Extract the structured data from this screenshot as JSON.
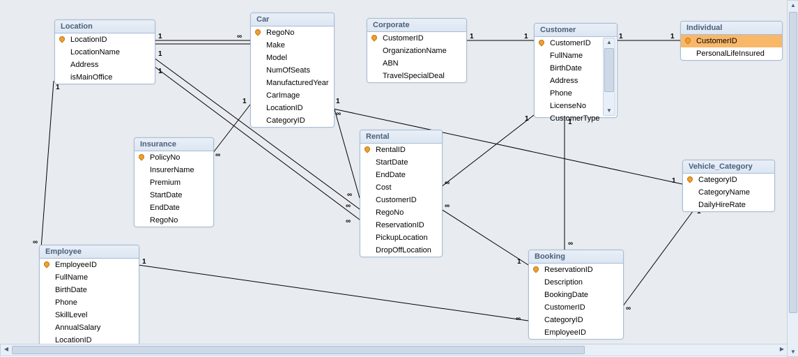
{
  "app": "Microsoft Access Relationships",
  "colors": {
    "canvas": "#e8ecf0",
    "entity_border": "#a7bcd8",
    "title_bg": "#dce6f2",
    "selected": "#f9b769",
    "pk_icon": "#f0a030"
  },
  "entities": [
    {
      "name": "Location",
      "pk": [
        "LocationID"
      ],
      "fields": [
        "LocationID",
        "LocationName",
        "Address",
        "isMainOffice"
      ]
    },
    {
      "name": "Car",
      "pk": [
        "RegoNo"
      ],
      "fields": [
        "RegoNo",
        "Make",
        "Model",
        "NumOfSeats",
        "ManufacturedYear",
        "CarImage",
        "LocationID",
        "CategoryID"
      ]
    },
    {
      "name": "Corporate",
      "pk": [
        "CustomerID"
      ],
      "fields": [
        "CustomerID",
        "OrganizationName",
        "ABN",
        "TravelSpecialDeal"
      ]
    },
    {
      "name": "Customer",
      "pk": [
        "CustomerID"
      ],
      "fields": [
        "CustomerID",
        "FullName",
        "BirthDate",
        "Address",
        "Phone",
        "LicenseNo",
        "CustomerType"
      ],
      "has_scroll": true
    },
    {
      "name": "Individual",
      "pk": [
        "CustomerID"
      ],
      "fields": [
        "CustomerID",
        "PersonalLifeInsured"
      ],
      "selected_field": "CustomerID"
    },
    {
      "name": "Insurance",
      "pk": [
        "PolicyNo"
      ],
      "fields": [
        "PolicyNo",
        "InsurerName",
        "Premium",
        "StartDate",
        "EndDate",
        "RegoNo"
      ]
    },
    {
      "name": "Rental",
      "pk": [
        "RentalID"
      ],
      "fields": [
        "RentalID",
        "StartDate",
        "EndDate",
        "Cost",
        "CustomerID",
        "RegoNo",
        "ReservationID",
        "PickupLocation",
        "DropOffLocation"
      ]
    },
    {
      "name": "Vehicle_Category",
      "pk": [
        "CategoryID"
      ],
      "fields": [
        "CategoryID",
        "CategoryName",
        "DailyHireRate"
      ]
    },
    {
      "name": "Employee",
      "pk": [
        "EmployeeID"
      ],
      "fields": [
        "EmployeeID",
        "FullName",
        "BirthDate",
        "Phone",
        "SkillLevel",
        "AnnualSalary",
        "LocationID"
      ]
    },
    {
      "name": "Booking",
      "pk": [
        "ReservationID"
      ],
      "fields": [
        "ReservationID",
        "Description",
        "BookingDate",
        "CustomerID",
        "CategoryID",
        "EmployeeID"
      ]
    }
  ],
  "relationships": [
    {
      "from": "Location.LocationID",
      "to": "Car.LocationID",
      "card": "1:∞"
    },
    {
      "from": "Location.LocationID",
      "to": "Rental.PickupLocation",
      "card": "1:∞"
    },
    {
      "from": "Location.LocationID",
      "to": "Rental.DropOffLocation",
      "card": "1:∞"
    },
    {
      "from": "Location.LocationID",
      "to": "Employee.LocationID",
      "card": "1:∞"
    },
    {
      "from": "Car.RegoNo",
      "to": "Insurance.RegoNo",
      "card": "1:∞"
    },
    {
      "from": "Car.RegoNo",
      "to": "Rental.RegoNo",
      "card": "1:∞"
    },
    {
      "from": "Vehicle_Category.CategoryID",
      "to": "Car.CategoryID",
      "card": "1:∞"
    },
    {
      "from": "Customer.CustomerID",
      "to": "Corporate.CustomerID",
      "card": "1:1"
    },
    {
      "from": "Customer.CustomerID",
      "to": "Individual.CustomerID",
      "card": "1:1"
    },
    {
      "from": "Customer.CustomerID",
      "to": "Rental.CustomerID",
      "card": "1:∞"
    },
    {
      "from": "Customer.CustomerID",
      "to": "Booking.CustomerID",
      "card": "1:∞"
    },
    {
      "from": "Booking.ReservationID",
      "to": "Rental.ReservationID",
      "card": "1:∞"
    },
    {
      "from": "Employee.EmployeeID",
      "to": "Booking.EmployeeID",
      "card": "1:∞"
    },
    {
      "from": "Vehicle_Category.CategoryID",
      "to": "Booking.CategoryID",
      "card": "1:∞"
    }
  ]
}
